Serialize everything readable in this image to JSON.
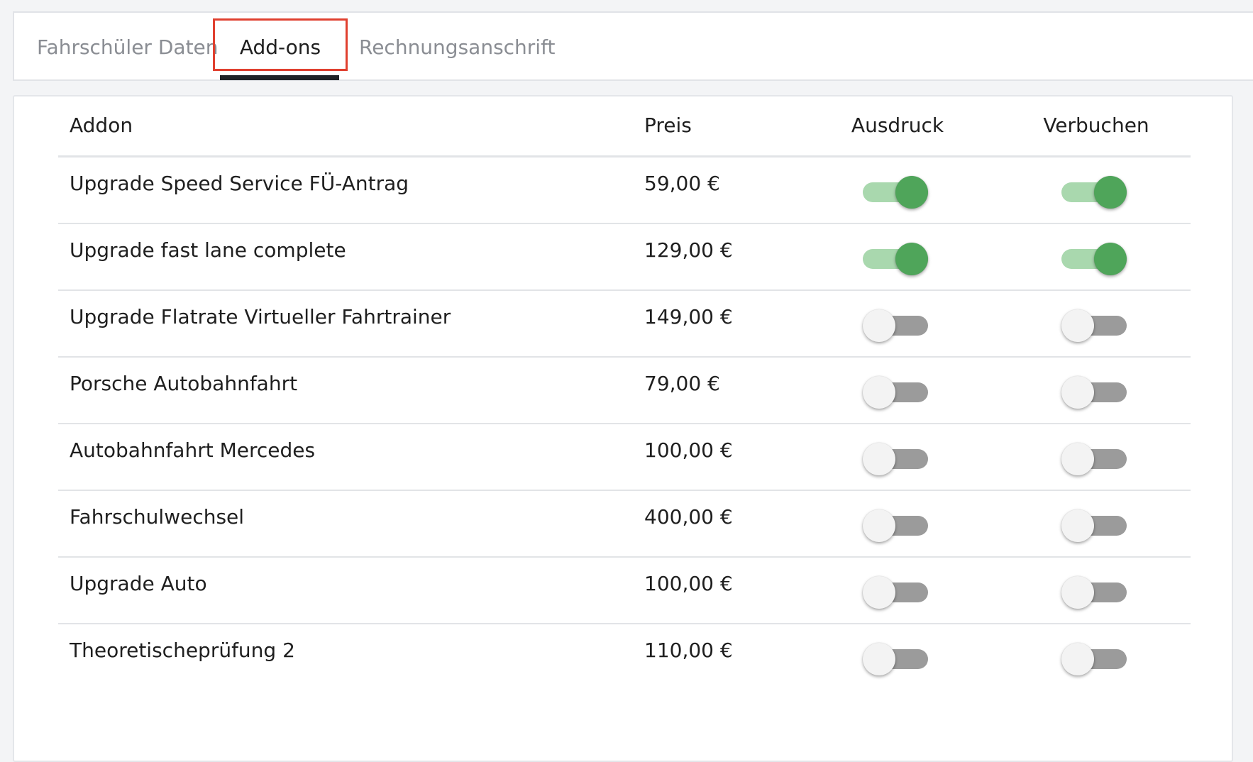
{
  "tabs": [
    {
      "label": "Fahrschüler Daten",
      "active": false
    },
    {
      "label": "Add-ons",
      "active": true
    },
    {
      "label": "Rechnungsanschrift",
      "active": false
    }
  ],
  "table": {
    "headers": {
      "addon": "Addon",
      "preis": "Preis",
      "ausdruck": "Ausdruck",
      "verbuchen": "Verbuchen"
    },
    "rows": [
      {
        "name": "Upgrade Speed Service FÜ-Antrag",
        "price": "59,00 €",
        "ausdruck": true,
        "verbuchen": true
      },
      {
        "name": "Upgrade fast lane complete",
        "price": "129,00 €",
        "ausdruck": true,
        "verbuchen": true
      },
      {
        "name": "Upgrade Flatrate Virtueller Fahrtrainer",
        "price": "149,00 €",
        "ausdruck": false,
        "verbuchen": false
      },
      {
        "name": "Porsche Autobahnfahrt",
        "price": "79,00 €",
        "ausdruck": false,
        "verbuchen": false
      },
      {
        "name": "Autobahnfahrt Mercedes",
        "price": "100,00 €",
        "ausdruck": false,
        "verbuchen": false
      },
      {
        "name": "Fahrschulwechsel",
        "price": "400,00 €",
        "ausdruck": false,
        "verbuchen": false
      },
      {
        "name": "Upgrade Auto",
        "price": "100,00 €",
        "ausdruck": false,
        "verbuchen": false
      },
      {
        "name": "Theoretischeprüfung 2",
        "price": "110,00 €",
        "ausdruck": false,
        "verbuchen": false
      }
    ]
  },
  "colors": {
    "switch_on_knob": "#4fa55a",
    "switch_on_track": "#a9d8ae",
    "switch_off_knob": "#f3f3f3",
    "switch_off_track": "#9b9b9b",
    "tab_highlight": "#e0402f",
    "active_tab_underline": "#1f2226"
  }
}
